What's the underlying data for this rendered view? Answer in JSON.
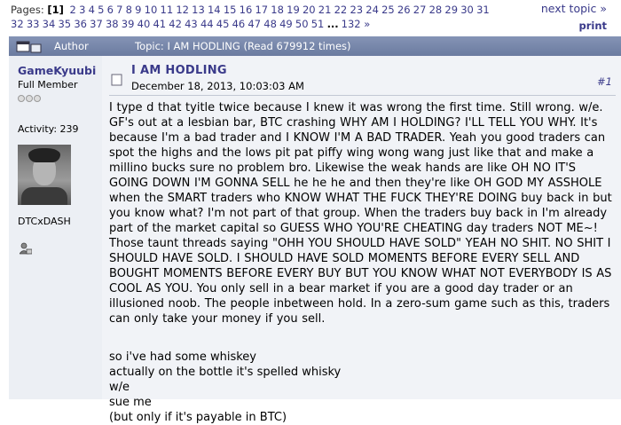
{
  "pagination": {
    "label": "Pages:",
    "current_page": "[1]",
    "row1_pages": [
      "2",
      "3",
      "4",
      "5",
      "6",
      "7",
      "8",
      "9",
      "10",
      "11",
      "12",
      "13",
      "14",
      "15",
      "16",
      "17",
      "18",
      "19",
      "20",
      "21",
      "22",
      "23",
      "24",
      "25",
      "26",
      "27",
      "28",
      "29",
      "30",
      "31"
    ],
    "row2_pages": [
      "32",
      "33",
      "34",
      "35",
      "36",
      "37",
      "38",
      "39",
      "40",
      "41",
      "42",
      "43",
      "44",
      "45",
      "46",
      "47",
      "48",
      "49",
      "50",
      "51"
    ],
    "ellipsis": "...",
    "last_page": "132",
    "last_arrow": "»"
  },
  "nav": {
    "next_topic": "next topic »",
    "print": "print"
  },
  "header": {
    "author_label": "Author",
    "topic_label": "Topic: I AM HODLING  (Read 679912 times)"
  },
  "poster": {
    "username": "GameKyuubi",
    "rank": "Full Member",
    "stars": 3,
    "activity": "Activity: 239",
    "personal_text": "DTCxDASH"
  },
  "post": {
    "subject": "I AM HODLING",
    "date": "December 18, 2013, 10:03:03 AM",
    "number": "#1",
    "body": "I type d that tyitle twice because I knew it was wrong the first time.  Still wrong.  w/e.  GF's out at a lesbian bar, BTC crashing WHY AM I HOLDING? I'LL TELL YOU WHY.  It's because I'm a bad trader and I KNOW I'M A BAD TRADER.  Yeah you good traders can spot the highs and the lows pit pat piffy wing wong wang just like that and make a millino bucks sure no problem bro.  Likewise the weak hands are like OH NO IT'S GOING DOWN I'M GONNA SELL he he he and then they're like OH GOD MY ASSHOLE when the SMART traders who KNOW WHAT THE FUCK THEY'RE DOING buy back in but you know what?  I'm not part of that group.  When the traders buy back in I'm already part of the market capital so GUESS WHO YOU'RE CHEATING day traders NOT ME~!  Those taunt threads saying \"OHH YOU SHOULD HAVE SOLD\" YEAH NO SHIT.  NO SHIT I SHOULD HAVE SOLD.  I SHOULD HAVE SOLD MOMENTS BEFORE EVERY SELL AND BOUGHT MOMENTS BEFORE EVERY BUY BUT YOU KNOW WHAT NOT EVERYBODY IS AS COOL AS YOU.  You only sell in a bear market if you are a good day trader or an illusioned noob.  The people inbetween hold.  In a zero-sum game such as this, traders can only take your money if you sell.",
    "line1": "so i've had some whiskey",
    "line2": "actually on the bottle it's spelled whisky",
    "line3": "w/e",
    "line4": "sue me",
    "line5": "(but only if it's payable in BTC)"
  },
  "colors": {
    "link": "#3a3a8a",
    "header_bg": "#7483a9",
    "post_bg": "#f1f3f7"
  },
  "icons": {
    "header": "topic-icon",
    "message": "message-icon",
    "profile": "profile-icon"
  }
}
